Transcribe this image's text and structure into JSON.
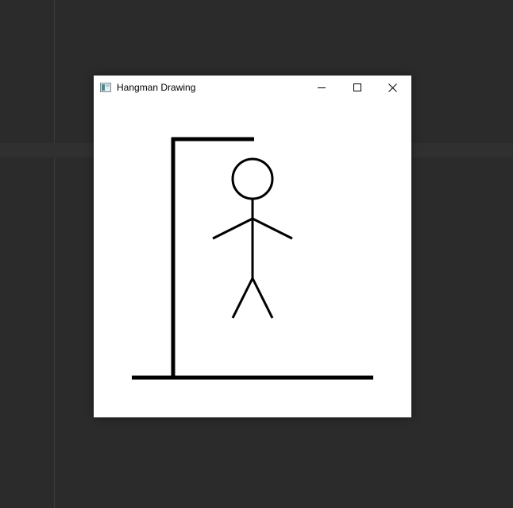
{
  "window": {
    "title": "Hangman Drawing",
    "controls": [
      "minimize-icon",
      "maximize-icon",
      "close-icon"
    ]
  },
  "canvas": {
    "drawing": "hangman",
    "parts_shown": [
      "base",
      "pole",
      "beam",
      "head",
      "body",
      "left-arm",
      "right-arm",
      "left-leg",
      "right-leg"
    ],
    "stroke_color": "#000000",
    "background": "#ffffff"
  },
  "desktop": {
    "background": "#2b2b2b"
  }
}
